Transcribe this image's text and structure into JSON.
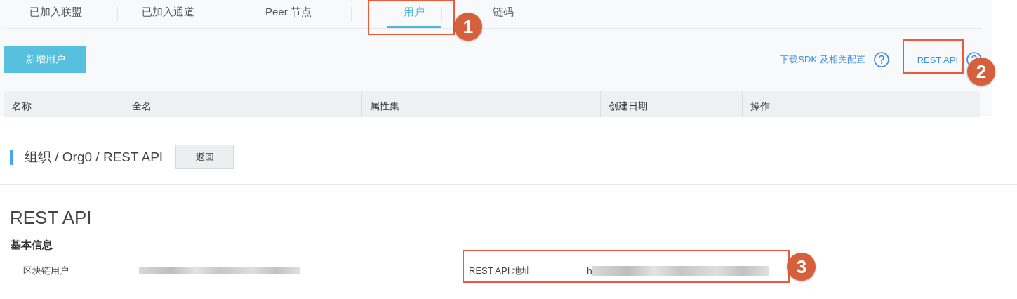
{
  "tabs": [
    {
      "label": "已加入联盟",
      "selected": false
    },
    {
      "label": "已加入通道",
      "selected": false
    },
    {
      "label": "Peer 节点",
      "selected": false
    },
    {
      "label": "用户",
      "selected": true
    },
    {
      "label": "链码",
      "selected": false
    }
  ],
  "add_button": "新增用户",
  "links": [
    {
      "label": "下载SDK 及相关配置"
    },
    {
      "label": "REST API"
    }
  ],
  "table": {
    "columns": [
      "名称",
      "全名",
      "属性集",
      "创建日期",
      "操作"
    ]
  },
  "breadcrumb": "组织 / Org0 / REST API",
  "back_button": "返回",
  "section_title": "REST API",
  "subsection_title": "基本信息",
  "fields": [
    {
      "label": "区块链用户"
    },
    {
      "label": "REST API 地址",
      "value_prefix": "h"
    }
  ],
  "callouts": [
    "1",
    "2",
    "3"
  ]
}
